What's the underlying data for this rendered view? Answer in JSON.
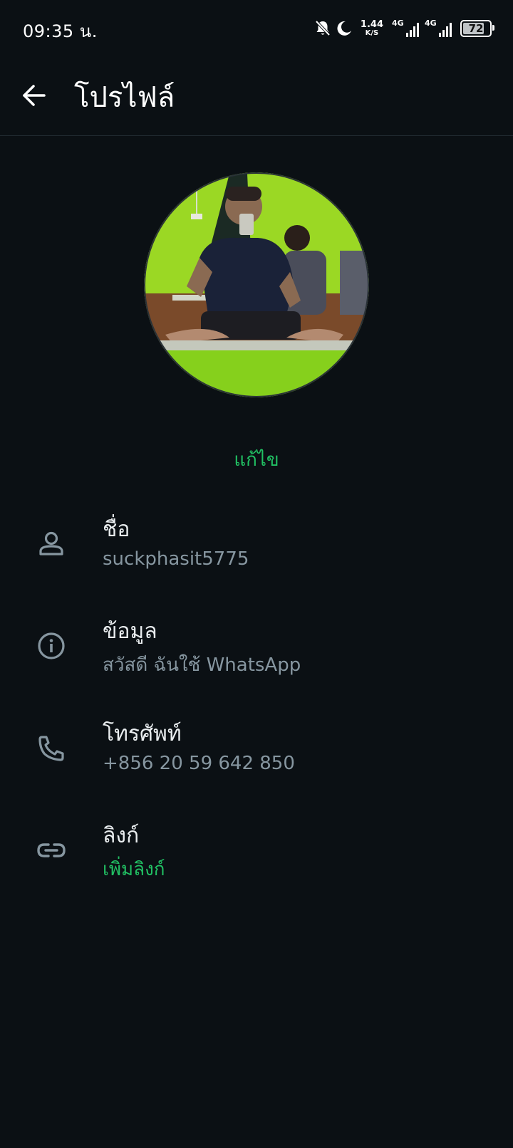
{
  "status_bar": {
    "time": "09:35 น.",
    "net_speed_value": "1.44",
    "net_speed_unit": "K/S",
    "sim1_label": "4G",
    "sim2_label": "4G",
    "battery_level": 72,
    "battery_text": "72"
  },
  "header": {
    "title": "โปรไฟล์"
  },
  "profile": {
    "edit_label": "แก้ไข"
  },
  "rows": {
    "name": {
      "label": "ชื่อ",
      "value": "suckphasit5775"
    },
    "about": {
      "label": "ข้อมูล",
      "value": "สวัสดี ฉันใช้ WhatsApp"
    },
    "phone": {
      "label": "โทรศัพท์",
      "value": "+856 20 59 642 850"
    },
    "links": {
      "label": "ลิงก์",
      "value": "เพิ่มลิงก์"
    }
  },
  "colors": {
    "background": "#0b1014",
    "accent": "#21c063",
    "secondary_text": "#8696a0",
    "primary_text": "#e9edef"
  }
}
